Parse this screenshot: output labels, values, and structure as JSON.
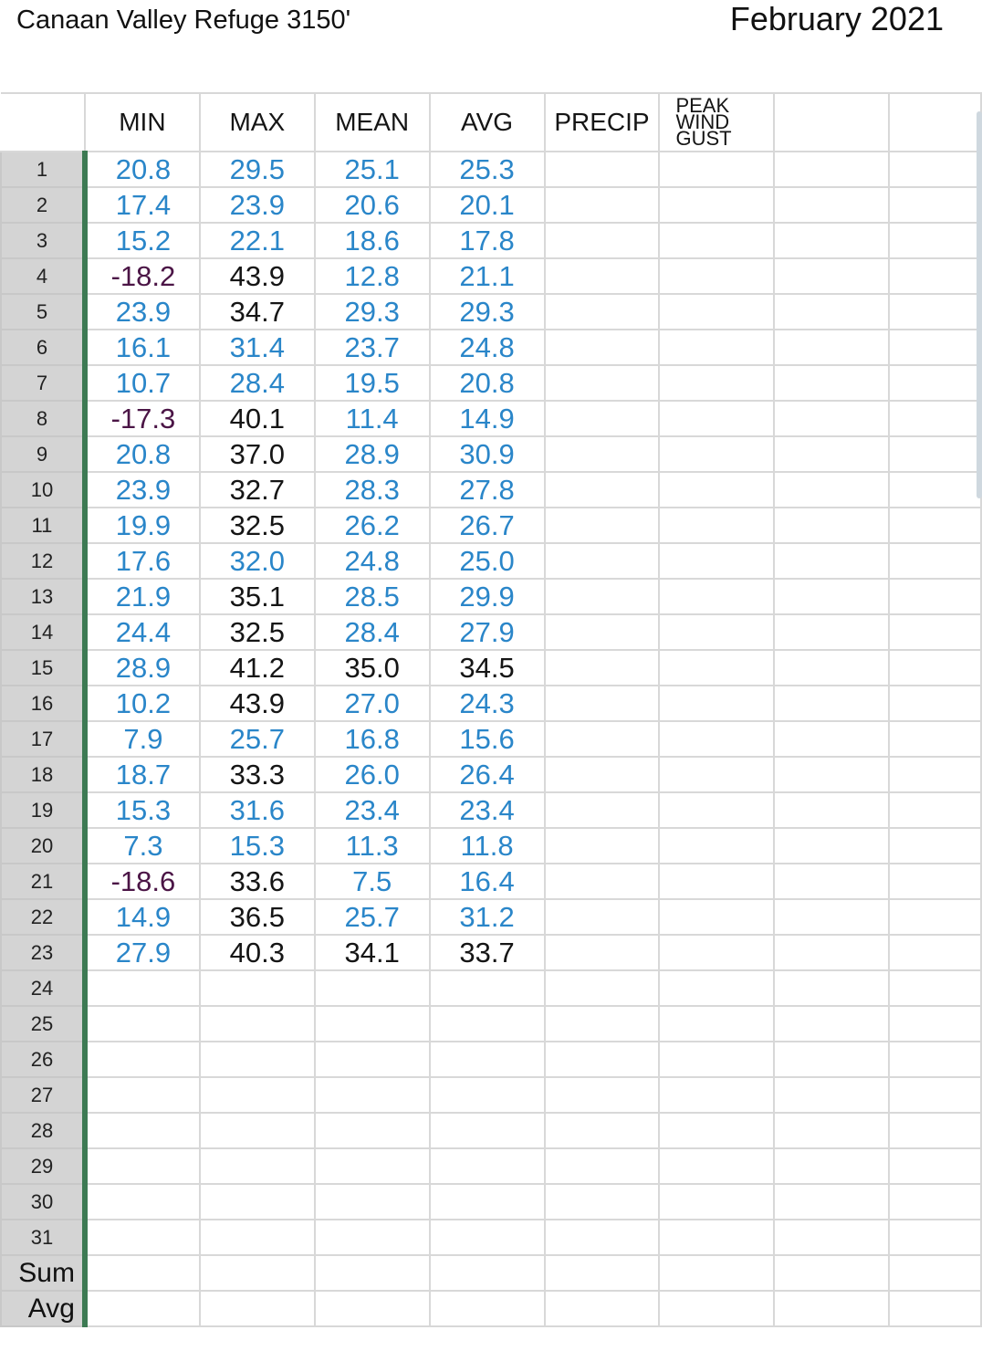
{
  "header": {
    "title": "Canaan Valley Refuge 3150'",
    "month": "February 2021"
  },
  "columns": [
    "MIN",
    "MAX",
    "MEAN",
    "AVG",
    "PRECIP",
    "PEAK WIND GUST",
    ""
  ],
  "peak_wind_lines": [
    "PEAK",
    "WIND",
    "GUST"
  ],
  "row_labels": [
    "1",
    "2",
    "3",
    "4",
    "5",
    "6",
    "7",
    "8",
    "9",
    "10",
    "11",
    "12",
    "13",
    "14",
    "15",
    "16",
    "17",
    "18",
    "19",
    "20",
    "21",
    "22",
    "23",
    "24",
    "25",
    "26",
    "27",
    "28",
    "29",
    "30",
    "31",
    "Sum",
    "Avg"
  ],
  "rows": [
    {
      "min": "20.8",
      "max": "29.5",
      "mean": "25.1",
      "avg": "25.3"
    },
    {
      "min": "17.4",
      "max": "23.9",
      "mean": "20.6",
      "avg": "20.1"
    },
    {
      "min": "15.2",
      "max": "22.1",
      "mean": "18.6",
      "avg": "17.8"
    },
    {
      "min": "-18.2",
      "max": "43.9",
      "mean": "12.8",
      "avg": "21.1"
    },
    {
      "min": "23.9",
      "max": "34.7",
      "mean": "29.3",
      "avg": "29.3"
    },
    {
      "min": "16.1",
      "max": "31.4",
      "mean": "23.7",
      "avg": "24.8"
    },
    {
      "min": "10.7",
      "max": "28.4",
      "mean": "19.5",
      "avg": "20.8"
    },
    {
      "min": "-17.3",
      "max": "40.1",
      "mean": "11.4",
      "avg": "14.9"
    },
    {
      "min": "20.8",
      "max": "37.0",
      "mean": "28.9",
      "avg": "30.9"
    },
    {
      "min": "23.9",
      "max": "32.7",
      "mean": "28.3",
      "avg": "27.8"
    },
    {
      "min": "19.9",
      "max": "32.5",
      "mean": "26.2",
      "avg": "26.7"
    },
    {
      "min": "17.6",
      "max": "32.0",
      "mean": "24.8",
      "avg": "25.0"
    },
    {
      "min": "21.9",
      "max": "35.1",
      "mean": "28.5",
      "avg": "29.9"
    },
    {
      "min": "24.4",
      "max": "32.5",
      "mean": "28.4",
      "avg": "27.9"
    },
    {
      "min": "28.9",
      "max": "41.2",
      "mean": "35.0",
      "avg": "34.5"
    },
    {
      "min": "10.2",
      "max": "43.9",
      "mean": "27.0",
      "avg": "24.3"
    },
    {
      "min": "7.9",
      "max": "25.7",
      "mean": "16.8",
      "avg": "15.6"
    },
    {
      "min": "18.7",
      "max": "33.3",
      "mean": "26.0",
      "avg": "26.4"
    },
    {
      "min": "15.3",
      "max": "31.6",
      "mean": "23.4",
      "avg": "23.4"
    },
    {
      "min": "7.3",
      "max": "15.3",
      "mean": "11.3",
      "avg": "11.8"
    },
    {
      "min": "-18.6",
      "max": "33.6",
      "mean": "7.5",
      "avg": "16.4"
    },
    {
      "min": "14.9",
      "max": "36.5",
      "mean": "25.7",
      "avg": "31.2"
    },
    {
      "min": "27.9",
      "max": "40.3",
      "mean": "34.1",
      "avg": "33.7"
    }
  ],
  "colors": {
    "above_freezing_value": "#151515",
    "below_freezing_value": "#2a86c9",
    "negative_value": "#4b1546",
    "row_header_bg": "#d4d4d4",
    "freeze_pane_bar": "#3d7a53",
    "gridline": "#d8d8d8"
  }
}
